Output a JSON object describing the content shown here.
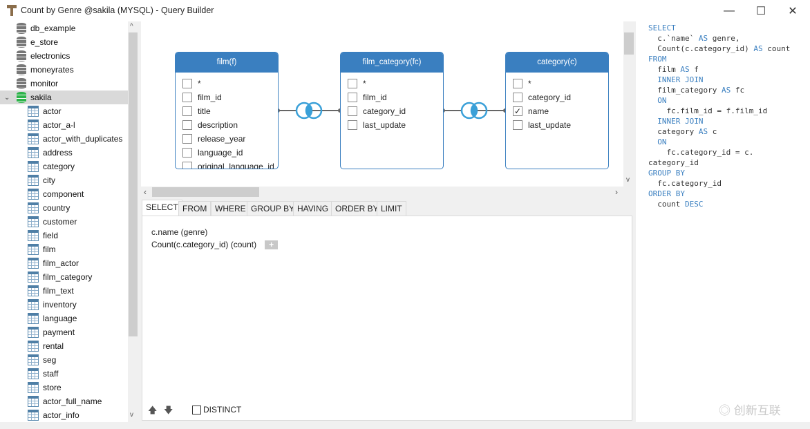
{
  "window": {
    "title": "Count by Genre @sakila (MYSQL) - Query Builder",
    "controls": [
      "minimize",
      "maximize",
      "close"
    ]
  },
  "tree": {
    "schemas": [
      {
        "label": "db_example"
      },
      {
        "label": "e_store"
      },
      {
        "label": "electronics"
      },
      {
        "label": "moneyrates"
      },
      {
        "label": "monitor"
      },
      {
        "label": "sakila",
        "expanded": true,
        "active": true
      }
    ],
    "tables": [
      "actor",
      "actor_a-l",
      "actor_with_duplicates",
      "address",
      "category",
      "city",
      "component",
      "country",
      "customer",
      "field",
      "film",
      "film_actor",
      "film_category",
      "film_text",
      "inventory",
      "language",
      "payment",
      "rental",
      "seg",
      "staff",
      "store"
    ],
    "views": [
      "actor_full_name",
      "actor_info"
    ]
  },
  "diagram": {
    "tables": [
      {
        "title": "film(f)",
        "fields": [
          {
            "name": "*",
            "checked": false
          },
          {
            "name": "film_id",
            "checked": false
          },
          {
            "name": "title",
            "checked": false
          },
          {
            "name": "description",
            "checked": false
          },
          {
            "name": "release_year",
            "checked": false
          },
          {
            "name": "language_id",
            "checked": false
          },
          {
            "name": "original_language_id",
            "checked": false
          }
        ]
      },
      {
        "title": "film_category(fc)",
        "fields": [
          {
            "name": "*",
            "checked": false
          },
          {
            "name": "film_id",
            "checked": false
          },
          {
            "name": "category_id",
            "checked": false
          },
          {
            "name": "last_update",
            "checked": false
          }
        ]
      },
      {
        "title": "category(c)",
        "fields": [
          {
            "name": "*",
            "checked": false
          },
          {
            "name": "category_id",
            "checked": false
          },
          {
            "name": "name",
            "checked": true
          },
          {
            "name": "last_update",
            "checked": false
          }
        ]
      }
    ],
    "join_type": "inner-join",
    "accent": "#3a7fc0"
  },
  "tabs": [
    {
      "label": "SELECT",
      "active": true
    },
    {
      "label": "FROM"
    },
    {
      "label": "WHERE"
    },
    {
      "label": "GROUP BY"
    },
    {
      "label": "HAVING"
    },
    {
      "label": "ORDER BY"
    },
    {
      "label": "LIMIT"
    }
  ],
  "select": {
    "items": [
      "c.name  (genre)",
      "Count(c.category_id)  (count)"
    ],
    "add_label": "+",
    "distinct_label": "DISTINCT",
    "distinct_checked": false
  },
  "sql": [
    [
      [
        "kw",
        "SELECT"
      ]
    ],
    [
      [
        "t",
        "  c.`name` "
      ],
      [
        "kw",
        "AS"
      ],
      [
        "t",
        " genre,"
      ]
    ],
    [
      [
        "t",
        "  Count(c.category_id) "
      ],
      [
        "kw",
        "AS"
      ],
      [
        "t",
        " count"
      ]
    ],
    [
      [
        "kw",
        "FROM"
      ]
    ],
    [
      [
        "t",
        "  film "
      ],
      [
        "kw",
        "AS"
      ],
      [
        "t",
        " f"
      ]
    ],
    [
      [
        "kw",
        "  INNER JOIN"
      ]
    ],
    [
      [
        "t",
        "  film_category "
      ],
      [
        "kw",
        "AS"
      ],
      [
        "t",
        " fc"
      ]
    ],
    [
      [
        "kw",
        "  ON"
      ]
    ],
    [
      [
        "t",
        "    fc.film_id = f.film_id"
      ]
    ],
    [
      [
        "kw",
        "  INNER JOIN"
      ]
    ],
    [
      [
        "t",
        "  category "
      ],
      [
        "kw",
        "AS"
      ],
      [
        "t",
        " c"
      ]
    ],
    [
      [
        "kw",
        "  ON"
      ]
    ],
    [
      [
        "t",
        "    fc.category_id = c."
      ]
    ],
    [
      [
        "t",
        "category_id"
      ]
    ],
    [
      [
        "kw",
        "GROUP BY"
      ]
    ],
    [
      [
        "t",
        "  fc.category_id"
      ]
    ],
    [
      [
        "kw",
        "ORDER BY"
      ]
    ],
    [
      [
        "t",
        "  count "
      ],
      [
        "kw",
        "DESC"
      ]
    ]
  ],
  "watermark": "创新互联"
}
